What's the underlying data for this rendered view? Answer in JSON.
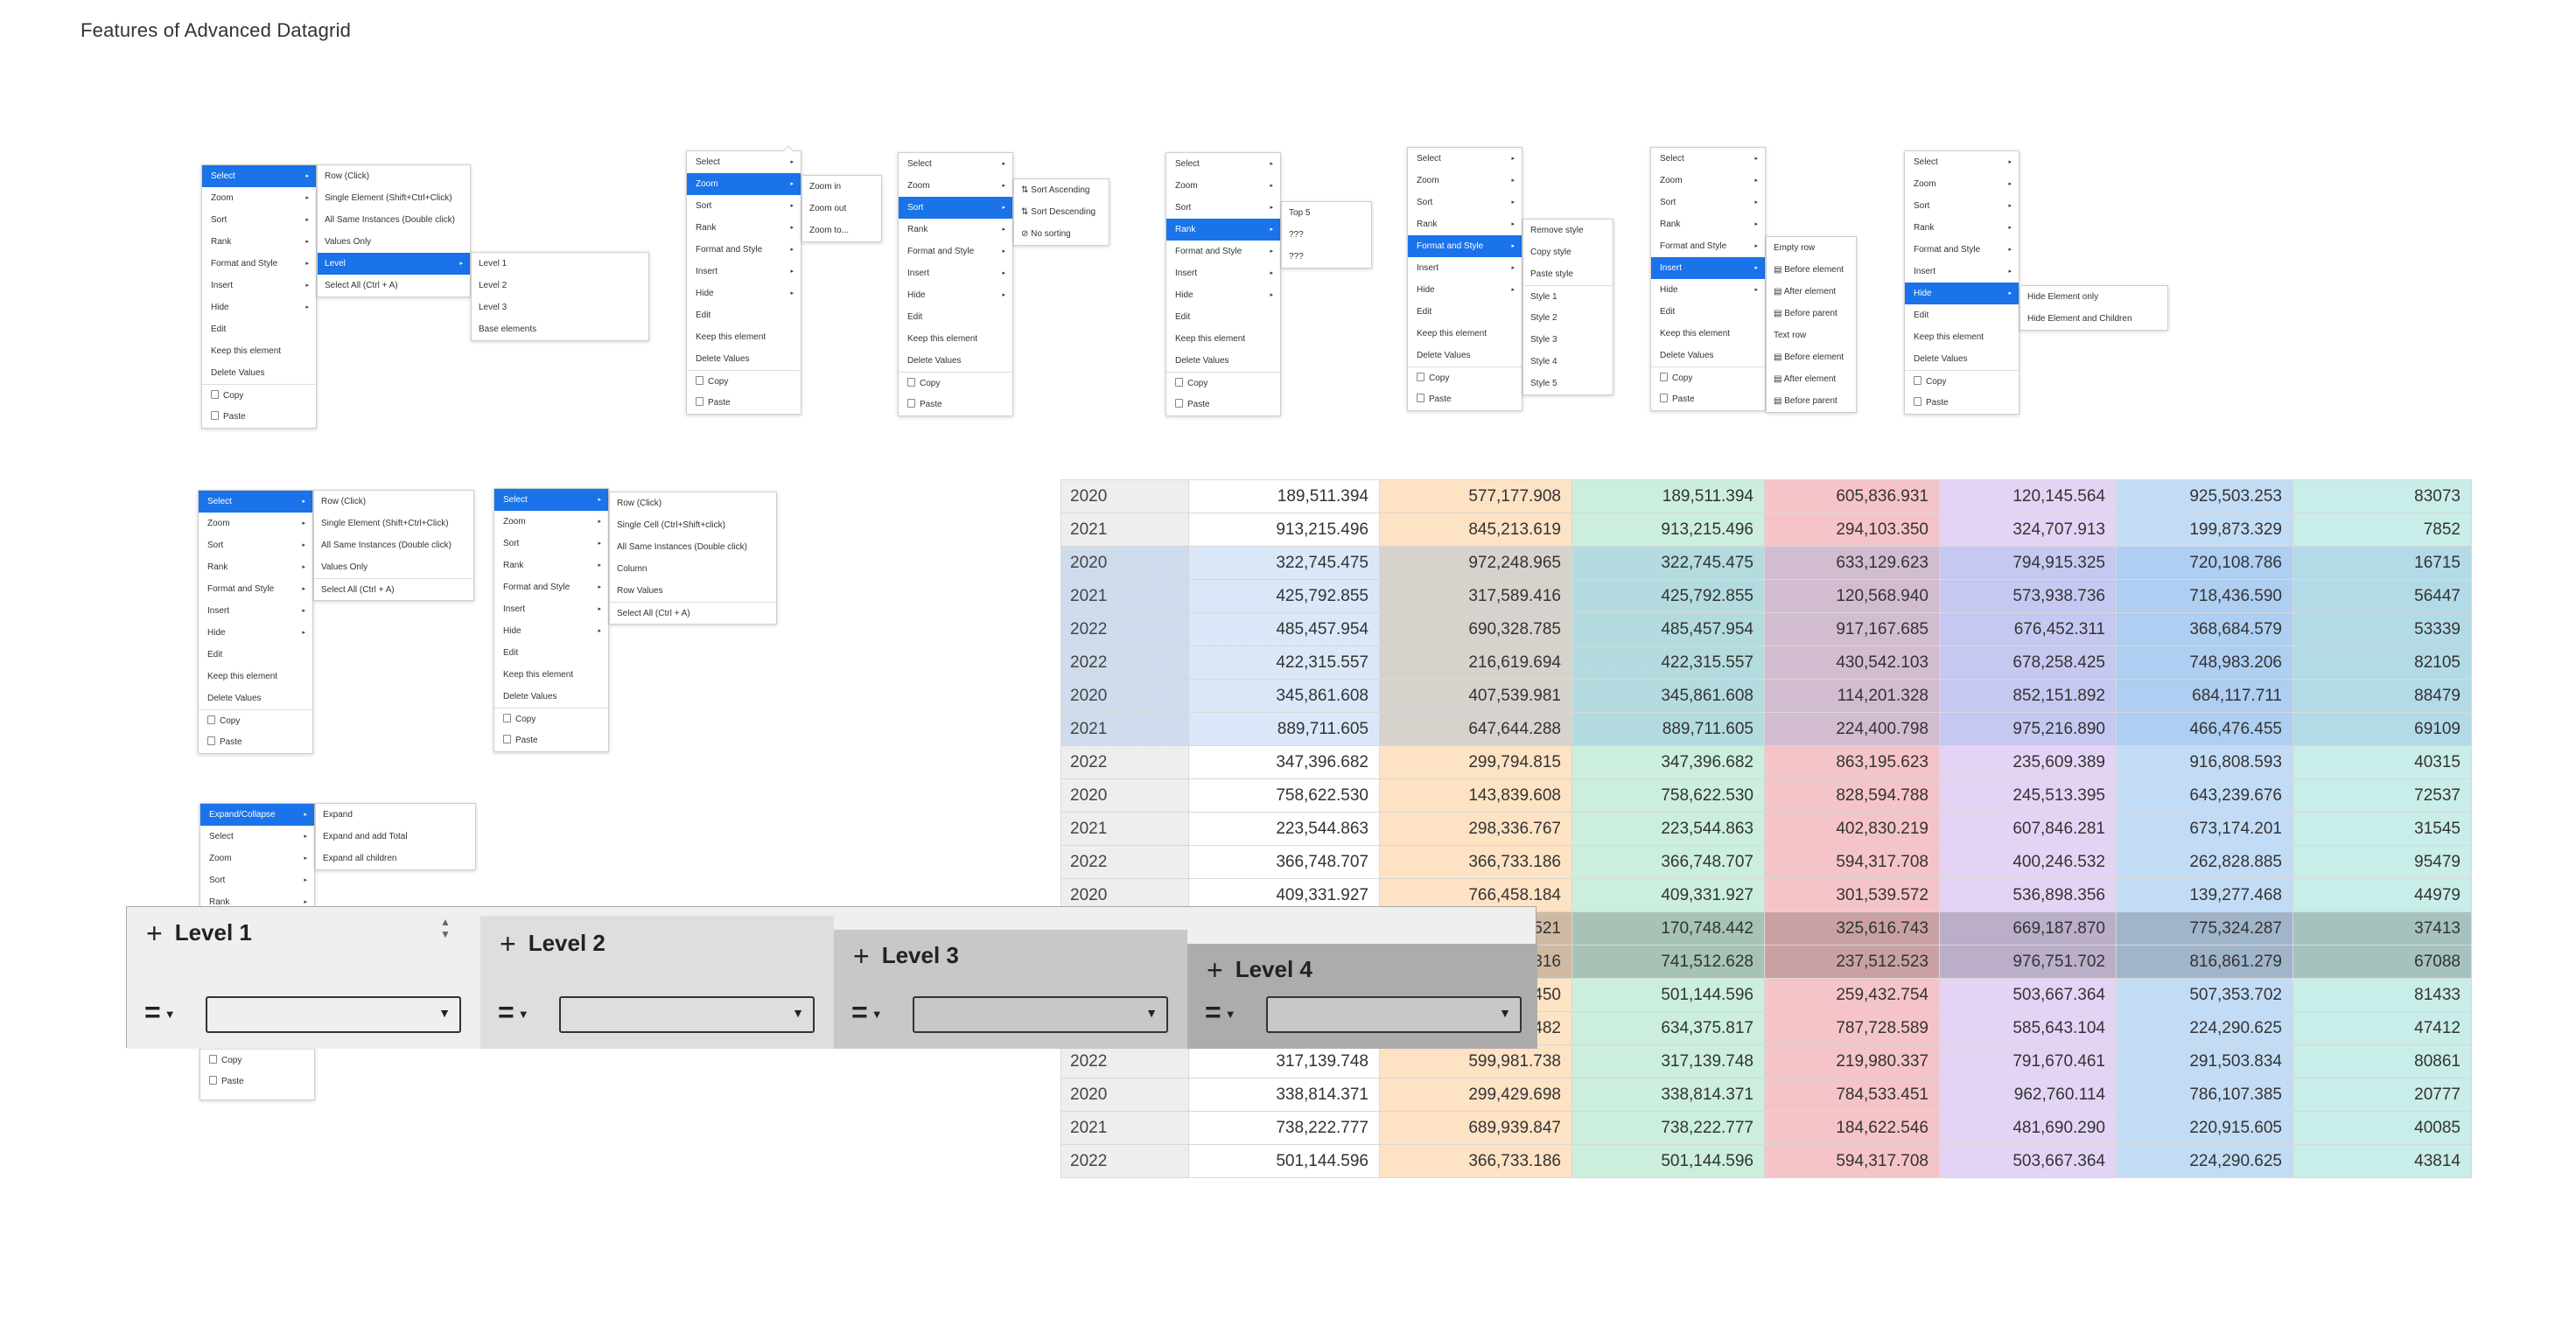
{
  "title": "Features of Advanced Datagrid",
  "menus": {
    "m1": [
      "Select",
      "Zoom",
      "Sort",
      "Rank",
      "Format and Style",
      "Insert",
      "Hide",
      "Edit",
      "Keep this element",
      "Delete Values",
      "Copy",
      "Paste"
    ],
    "m1_sub": [
      "Row (Click)",
      "Single Element (Shift+Ctrl+Click)",
      "All Same Instances (Double click)",
      "Values Only",
      "Level",
      "Select All (Ctrl + A)"
    ],
    "m1_sub2": [
      "Level 1",
      "Level 2",
      "Level 3",
      "Base elements"
    ],
    "m2_sub": [
      "Zoom in",
      "Zoom out",
      "Zoom to..."
    ],
    "m3_sub": [
      "Sort Ascending",
      "Sort Descending",
      "No sorting"
    ],
    "m4_sub": [
      "Top 5",
      "???",
      "???"
    ],
    "m5_sub": [
      "Remove style",
      "Copy style",
      "Paste style",
      "Style 1",
      "Style 2",
      "Style 3",
      "Style 4",
      "Style 5"
    ],
    "m6_sub": [
      "Empty row",
      "Before element",
      "After element",
      "Before parent",
      "Text row",
      "Before element",
      "After element",
      "Before parent"
    ],
    "m7_sub": [
      "Hide Element only",
      "Hide Element and Children"
    ],
    "m8_sub": [
      "Row (Click)",
      "Single Element (Shift+Ctrl+Click)",
      "All Same Instances (Double click)",
      "Values Only",
      "Select All (Ctrl + A)"
    ],
    "m9_sub": [
      "Row (Click)",
      "Single Cell (Ctrl+Shift+click)",
      "All Same Instances (Double click)",
      "Column",
      "Row Values",
      "Select All (Ctrl + A)"
    ],
    "m10": [
      "Expand/Collapse",
      "Select",
      "Zoom",
      "Sort",
      "Rank",
      "Copy",
      "Paste"
    ],
    "m10_sub": [
      "Expand",
      "Expand and add Total",
      "Expand all children"
    ]
  },
  "levels": [
    {
      "label": "Level 1",
      "operator": "="
    },
    {
      "label": "Level 2",
      "operator": "="
    },
    {
      "label": "Level 3",
      "operator": "="
    },
    {
      "label": "Level 4",
      "operator": "="
    }
  ],
  "grid": {
    "column_colors": [
      "#eeeeee",
      "#ffffff",
      "#fde2c4",
      "#cbeedd",
      "#f5c4c8",
      "#e3d4f5",
      "#c3dcf6",
      "#c9ede8"
    ],
    "rows": [
      [
        "2020",
        "189,511.394",
        "577,177.908",
        "189,511.394",
        "605,836.931",
        "120,145.564",
        "925,503.253",
        "83073"
      ],
      [
        "2021",
        "913,215.496",
        "845,213.619",
        "913,215.496",
        "294,103.350",
        "324,707.913",
        "199,873.329",
        "7852"
      ],
      [
        "2020",
        "322,745.475",
        "972,248.965",
        "322,745.475",
        "633,129.623",
        "794,915.325",
        "720,108.786",
        "16715"
      ],
      [
        "2021",
        "425,792.855",
        "317,589.416",
        "425,792.855",
        "120,568.940",
        "573,938.736",
        "718,436.590",
        "56447"
      ],
      [
        "2022",
        "485,457.954",
        "690,328.785",
        "485,457.954",
        "917,167.685",
        "676,452.311",
        "368,684.579",
        "53339"
      ],
      [
        "2022",
        "422,315.557",
        "216,619.694",
        "422,315.557",
        "430,542.103",
        "678,258.425",
        "748,983.206",
        "82105"
      ],
      [
        "2020",
        "345,861.608",
        "407,539.981",
        "345,861.608",
        "114,201.328",
        "852,151.892",
        "684,117.711",
        "88479"
      ],
      [
        "2021",
        "889,711.605",
        "647,644.288",
        "889,711.605",
        "224,400.798",
        "975,216.890",
        "466,476.455",
        "69109"
      ],
      [
        "2022",
        "347,396.682",
        "299,794.815",
        "347,396.682",
        "863,195.623",
        "235,609.389",
        "916,808.593",
        "40315"
      ],
      [
        "2020",
        "758,622.530",
        "143,839.608",
        "758,622.530",
        "828,594.788",
        "245,513.395",
        "643,239.676",
        "72537"
      ],
      [
        "2021",
        "223,544.863",
        "298,336.767",
        "223,544.863",
        "402,830.219",
        "607,846.281",
        "673,174.201",
        "31545"
      ],
      [
        "2022",
        "366,748.707",
        "366,733.186",
        "366,748.707",
        "594,317.708",
        "400,246.532",
        "262,828.885",
        "95479"
      ],
      [
        "2020",
        "409,331.927",
        "766,458.184",
        "409,331.927",
        "301,539.572",
        "536,898.356",
        "139,277.468",
        "44979"
      ],
      [
        "",
        "",
        "521",
        "170,748.442",
        "325,616.743",
        "669,187.870",
        "775,324.287",
        "37413"
      ],
      [
        "",
        "",
        "316",
        "741,512.628",
        "237,512.523",
        "976,751.702",
        "816,861.279",
        "67088"
      ],
      [
        "",
        "",
        "450",
        "501,144.596",
        "259,432.754",
        "503,667.364",
        "507,353.702",
        "81433"
      ],
      [
        "",
        "",
        "482",
        "634,375.817",
        "787,728.589",
        "585,643.104",
        "224,290.625",
        "47412"
      ],
      [
        "2022",
        "317,139.748",
        "599,981.738",
        "317,139.748",
        "219,980.337",
        "791,670.461",
        "291,503.834",
        "80861"
      ],
      [
        "2020",
        "338,814.371",
        "299,429.698",
        "338,814.371",
        "784,533.451",
        "962,760.114",
        "786,107.385",
        "20777"
      ],
      [
        "2021",
        "738,222.777",
        "689,939.847",
        "738,222.777",
        "184,622.546",
        "481,690.290",
        "220,915.605",
        "40085"
      ],
      [
        "2022",
        "501,144.596",
        "366,733.186",
        "501,144.596",
        "594,317.708",
        "503,667.364",
        "224,290.625",
        "43814"
      ]
    ]
  }
}
